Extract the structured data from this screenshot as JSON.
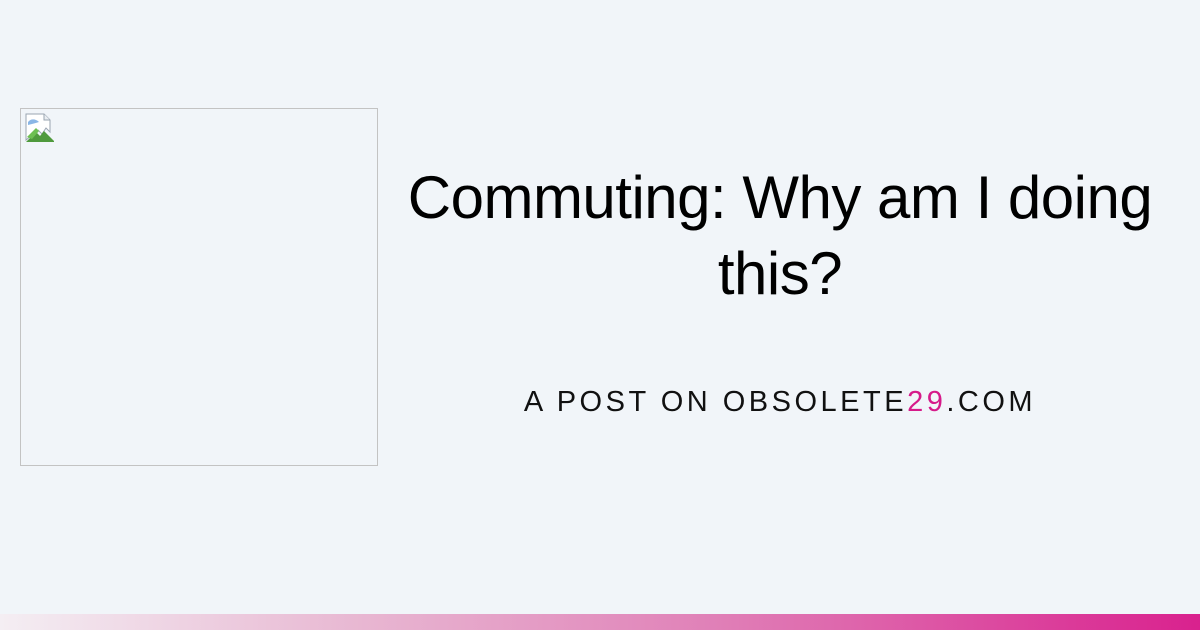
{
  "post": {
    "title": "Commuting: Why am I doing this?",
    "subtitle_prefix": "A POST ON OBSOLETE",
    "subtitle_accent": "29",
    "subtitle_suffix": ".COM"
  },
  "image": {
    "state": "broken-image",
    "icon": "broken-image-icon"
  },
  "colors": {
    "background": "#f1f5f9",
    "accent": "#d61a8a",
    "bar_end": "#d9218e"
  }
}
